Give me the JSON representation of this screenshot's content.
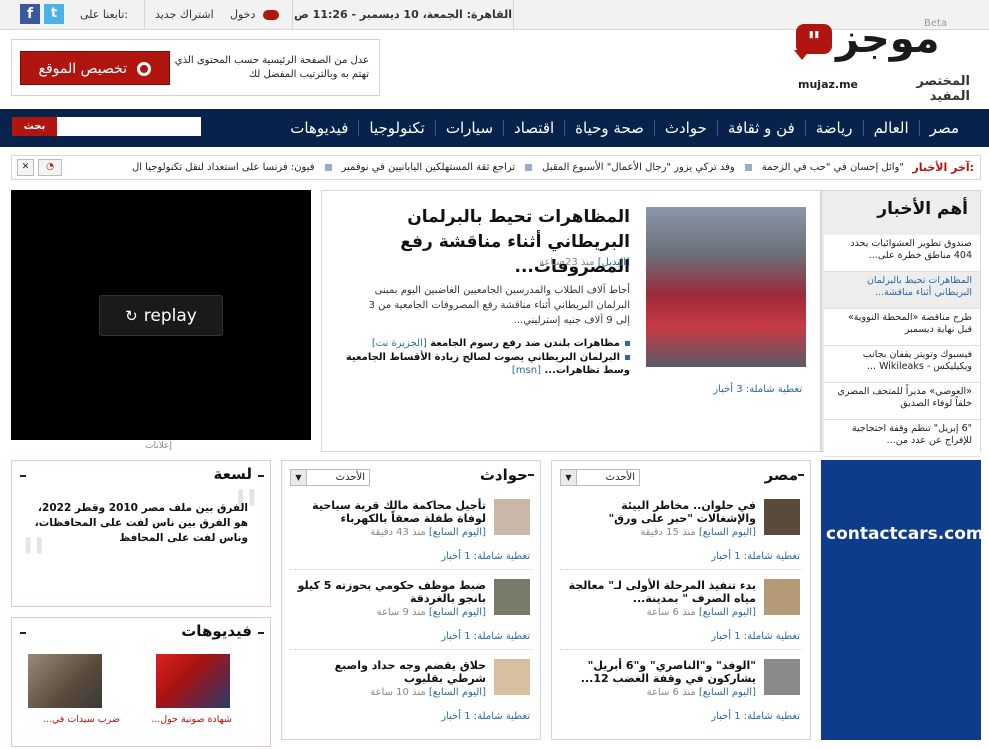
{
  "topbar": {
    "follow": "تابعنا على:",
    "subscribe": "اشتراك جديد",
    "login": "دخول",
    "datetime": "القاهرة: الجمعة، 10 ديسمبر - 11:26 ص"
  },
  "logo": {
    "name": "موجز",
    "beta": "Beta",
    "tagline": "المختصر المفيد",
    "domain": "mujaz.me"
  },
  "customize": {
    "button": "تخصيص الموقع",
    "text": "عدل من الصفحة الرئيسية حسب المحتوى الذي تهتم به وبالترتيب المفضل لك"
  },
  "nav": {
    "items": [
      "مصر",
      "العالم",
      "رياضة",
      "فن و ثقافة",
      "حوادث",
      "صحة وحياة",
      "اقتصاد",
      "سيارات",
      "تكنولوجيا",
      "فيديوهات"
    ]
  },
  "search": {
    "button": "بحث",
    "placeholder": ""
  },
  "ticker": {
    "label": "آخر الأخبار:",
    "items": [
      "وائل إحسان في \"حب في الزحمة\"",
      "وفد تركي يزور \"رجال الأعمال\" الأسبوع المقبل",
      "تراجع ثقة المستهلكين اليابانيين في نوفمبر",
      "فيون: فرنسا على استعداد لنقل تكنولوجيا ال"
    ]
  },
  "video": {
    "replay": "replay",
    "ads": "إعلانات"
  },
  "feature": {
    "title": "المظاهرات تحيط بالبرلمان البريطاني أثناء مناقشة رفع المصروفات...",
    "source": "[البديل]",
    "time": "منذ 23 ساعة",
    "desc": "أحاط آلاف الطلاب والمدرسين الجامعيين الغاضبين اليوم بمبنى البرلمان البريطاني أثناء مناقشة رفع المصروفات الجامعية من 3 إلى 9 آلاف جنيه إسترليني...",
    "links": [
      {
        "text": "مظاهرات بلندن ضد رفع رسوم الجامعة",
        "src": "[الجزيرة نت]"
      },
      {
        "text": "البرلمان البريطاني يصوت لصالح زيادة الأقساط الجامعية وسط تظاهرات...",
        "src": "[msn]"
      }
    ],
    "coverage": "تغطية شاملة: 3 أخبار"
  },
  "topnews": {
    "title": "أهم الأخبار",
    "items": [
      "صندوق تطوير العشوائيات يحدد 404 مناطق خطرة على...",
      "المظاهرات تحيط بالبرلمان البريطاني أثناء مناقشة...",
      "طرح مناقصة «المحطة النووية» قبل نهاية ديسمبر",
      "فيسبوك وتويتر يقفان بجانب ويكيليكس - Wikileaks ...",
      "«العوضي» مديراً للمتحف المصري خلفاً لوفاء الصديق",
      "\"6 إبريل\" تنظم وقفة احتجاجية للإفراج عن عدد من..."
    ]
  },
  "sections": {
    "misr": {
      "title": "مصر",
      "sort": "الأحدث",
      "items": [
        {
          "title": "في حلوان.. مخاطر البيئة والإشغالات \"حبر على ورق\"",
          "src": "[اليوم السابع]",
          "time": "منذ 15 دقيقة",
          "cov": "تغطية شاملة: 1 أخبار"
        },
        {
          "title": "بدء تنفيذ المرحلة الأولى لـ\" معالجة مياه الصرف \" بمدينة...",
          "src": "[اليوم السابع]",
          "time": "منذ 6 ساعة",
          "cov": "تغطية شاملة: 1 أخبار"
        },
        {
          "title": "\"الوفد\" و\"الناصري\" و\"6 أبريل\" يشاركون في وقفة الغضب 12...",
          "src": "[اليوم السابع]",
          "time": "منذ 6 ساعة",
          "cov": "تغطية شاملة: 1 أخبار"
        }
      ]
    },
    "hawadeth": {
      "title": "حوادث",
      "sort": "الأحدث",
      "items": [
        {
          "title": "تأجيل محاكمة مالك قرية سياحية لوفاة طفلة صعقاً بالكهرباء",
          "src": "[اليوم السابع]",
          "time": "منذ 43 دقيقة",
          "cov": "تغطية شاملة: 1 أخبار"
        },
        {
          "title": "ضبط موظف حكومي بحوزته 5 كيلو بانجو بالغردقة",
          "src": "[اليوم السابع]",
          "time": "منذ 9 ساعة",
          "cov": "تغطية شاملة: 1 أخبار"
        },
        {
          "title": "حلاق يقضم وجه حداد واصبع شرطي بقليوب",
          "src": "[اليوم السابع]",
          "time": "منذ 10 ساعة",
          "cov": "تغطية شاملة: 1 أخبار"
        }
      ]
    }
  },
  "ad": {
    "brand": "contactcars.com"
  },
  "lasaa": {
    "title": "لسعة",
    "text": "الفرق بين ملف مصر 2010 وقطر 2022، هو الفرق بين ناس لفت على المحافظات، وناس لفت على المحافظ"
  },
  "videos": {
    "title": "فيديوهات",
    "items": [
      {
        "caption": "شهادة صوتية حول..."
      },
      {
        "caption": "ضرب سيدات في..."
      }
    ]
  }
}
